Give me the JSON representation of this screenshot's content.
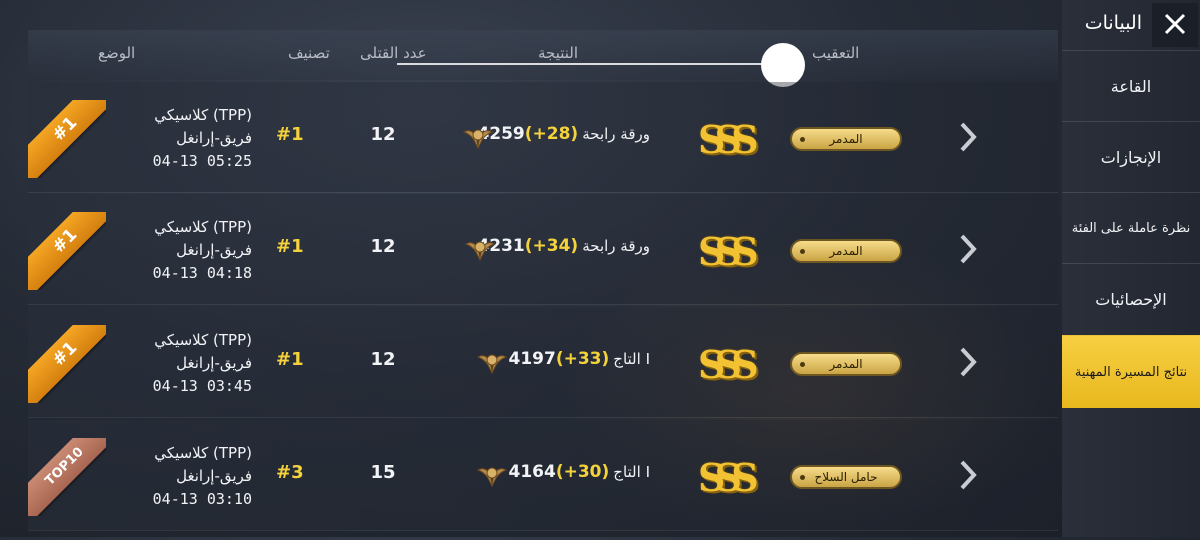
{
  "sidebar": {
    "title": "البيانات",
    "items": [
      {
        "label": "القاعة"
      },
      {
        "label": "الإنجازات"
      },
      {
        "label": "نظرة عاملة على الفئة"
      },
      {
        "label": "الإحصائيات"
      },
      {
        "label": "نتائج المسيرة المهنية",
        "active": true
      }
    ]
  },
  "columns": {
    "mode": "الوضع",
    "rank": "تصنيف",
    "kills": "عدد القتلى",
    "result": "النتيجة",
    "tracking": "التعقيب"
  },
  "colors": {
    "accent": "#f4d23b",
    "ribbon_gold": "#f5a623",
    "ribbon_top10": "#b8735d",
    "active_tab": "#f2c633"
  },
  "matches": [
    {
      "ribbon": "#1",
      "mode_line1": "كلاسيكي (TPP)",
      "mode_line2": "فريق-إرانغل",
      "date": "04-13 05:25",
      "rank": "#1",
      "kills": "12",
      "score": "4259",
      "delta": "(+28)",
      "tier": "ورقة رابحة",
      "tier_icon": "winged-badge-icon",
      "grade": "SSS",
      "title": "المدمر"
    },
    {
      "ribbon": "#1",
      "mode_line1": "كلاسيكي (TPP)",
      "mode_line2": "فريق-إرانغل",
      "date": "04-13 04:18",
      "rank": "#1",
      "kills": "12",
      "score": "4231",
      "delta": "(+34)",
      "tier": "ورقة رابحة",
      "tier_icon": "winged-badge-icon",
      "grade": "SSS",
      "title": "المدمر"
    },
    {
      "ribbon": "#1",
      "mode_line1": "كلاسيكي (TPP)",
      "mode_line2": "فريق-إرانغل",
      "date": "04-13 03:45",
      "rank": "#1",
      "kills": "12",
      "score": "4197",
      "delta": "(+33)",
      "tier": "التاج I",
      "tier_icon": "crown-badge-icon",
      "grade": "SSS",
      "title": "المدمر"
    },
    {
      "ribbon": "TOP10",
      "mode_line1": "كلاسيكي (TPP)",
      "mode_line2": "فريق-إرانغل",
      "date": "04-13 03:10",
      "rank": "#3",
      "kills": "15",
      "score": "4164",
      "delta": "(+30)",
      "tier": "التاج I",
      "tier_icon": "crown-badge-icon",
      "grade": "SSS",
      "title": "حامل السلاح"
    }
  ]
}
